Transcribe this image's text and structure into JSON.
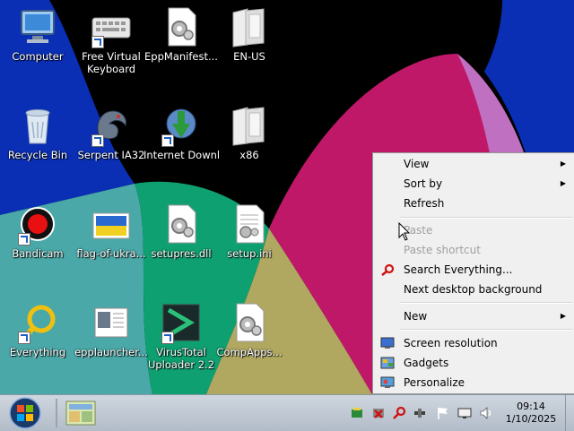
{
  "desktop": {
    "icons": [
      {
        "label": "Computer",
        "icon": "computer-icon"
      },
      {
        "label": "Free Virtual Keyboard",
        "icon": "keyboard-icon"
      },
      {
        "label": "EppManifest...",
        "icon": "config-file-icon"
      },
      {
        "label": "EN-US",
        "icon": "folder-icon"
      },
      {
        "label": "Recycle Bin",
        "icon": "recycle-bin-icon"
      },
      {
        "label": "Serpent IA32",
        "icon": "dragon-icon"
      },
      {
        "label": "Internet Downlo...",
        "icon": "idm-icon"
      },
      {
        "label": "x86",
        "icon": "folder-icon"
      },
      {
        "label": "Bandicam",
        "icon": "bandicam-icon"
      },
      {
        "label": "flag-of-ukra...",
        "icon": "flag-image-icon"
      },
      {
        "label": "setupres.dll",
        "icon": "dll-file-icon"
      },
      {
        "label": "setup.ini",
        "icon": "ini-file-icon"
      },
      {
        "label": "Everything",
        "icon": "everything-search-icon"
      },
      {
        "label": "epplauncher...",
        "icon": "launcher-icon"
      },
      {
        "label": "VirusTotal Uploader 2.2",
        "icon": "virustotal-icon"
      },
      {
        "label": "CompApps...",
        "icon": "config-file-icon"
      }
    ]
  },
  "context_menu": {
    "items": [
      {
        "label": "View",
        "enabled": true
      },
      {
        "label": "Sort by",
        "enabled": true
      },
      {
        "label": "Refresh",
        "enabled": true
      },
      {
        "label": "Paste",
        "enabled": false
      },
      {
        "label": "Paste shortcut",
        "enabled": false
      },
      {
        "label": "Search Everything...",
        "enabled": true,
        "icon": "magnifier-icon"
      },
      {
        "label": "Next desktop background",
        "enabled": true
      },
      {
        "label": "New",
        "enabled": true
      },
      {
        "label": "Screen resolution",
        "enabled": true,
        "icon": "monitor-icon"
      },
      {
        "label": "Gadgets",
        "enabled": true,
        "icon": "gadgets-icon"
      },
      {
        "label": "Personalize",
        "enabled": true,
        "icon": "personalize-icon"
      }
    ]
  },
  "taskbar": {
    "clock_time": "09:14",
    "clock_date": "1/10/2025"
  },
  "colors": {
    "wallpaper_blue": "#0a2fb5",
    "wallpaper_green": "#0ea070",
    "wallpaper_teal": "#4aa8a8",
    "wallpaper_olive": "#b0a860",
    "wallpaper_magenta": "#c01868",
    "wallpaper_pink": "#c070c0"
  }
}
